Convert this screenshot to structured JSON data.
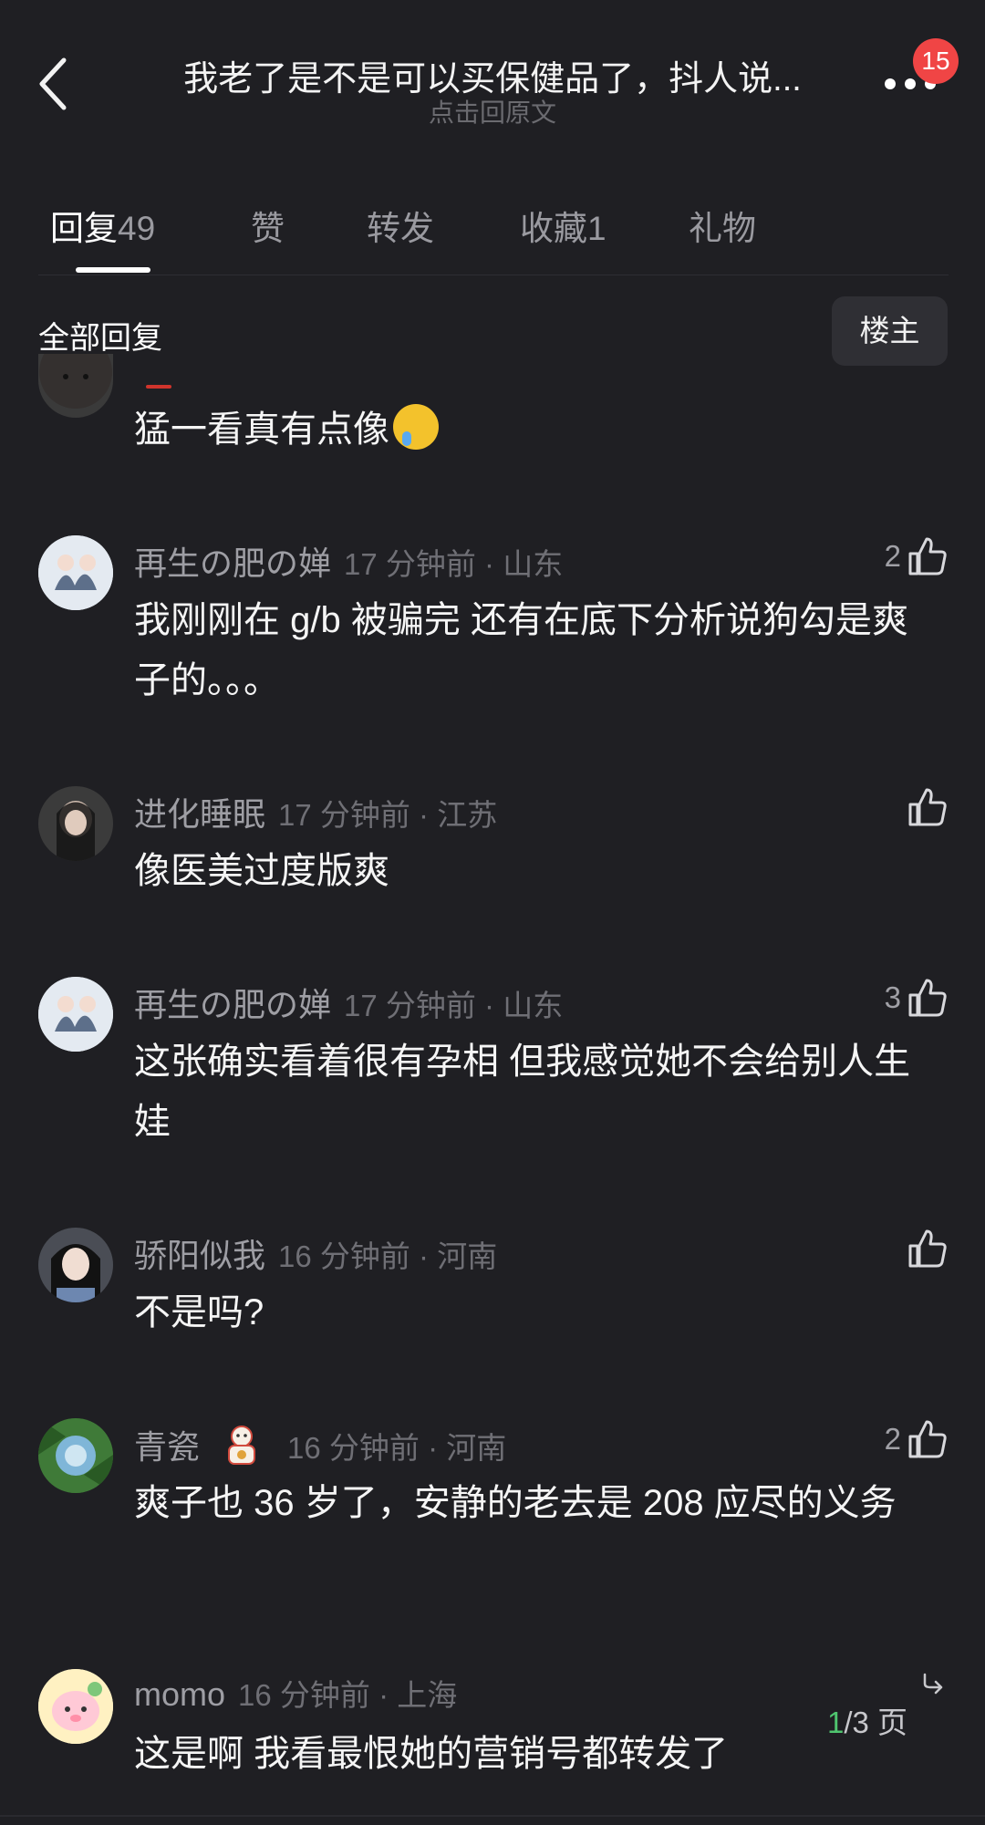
{
  "header": {
    "title": "我老了是不是可以买保健品了，抖人说...",
    "subtitle": "点击回原文",
    "notification_count": "15"
  },
  "tabs": [
    {
      "label": "回复",
      "count": "49"
    },
    {
      "label": "赞",
      "count": ""
    },
    {
      "label": "转发",
      "count": ""
    },
    {
      "label": "收藏",
      "count": "1"
    },
    {
      "label": "礼物",
      "count": ""
    }
  ],
  "section": {
    "label": "全部回复",
    "owner_button": "楼主"
  },
  "comments": [
    {
      "name": "",
      "meta": "",
      "text": "猛一看真有点像",
      "likes": ""
    },
    {
      "name": "再生の肥の婵",
      "meta": "17 分钟前 · 山东",
      "text": "我刚刚在 g/b 被骗完 还有在底下分析说狗勾是爽子的。。。",
      "likes": "2"
    },
    {
      "name": "进化睡眠",
      "meta": "17 分钟前 · 江苏",
      "text": "像医美过度版爽",
      "likes": ""
    },
    {
      "name": "再生の肥の婵",
      "meta": "17 分钟前 · 山东",
      "text": "这张确实看着很有孕相 但我感觉她不会给别人生娃",
      "likes": "3"
    },
    {
      "name": "骄阳似我",
      "meta": "16 分钟前 · 河南",
      "text": "不是吗?",
      "likes": ""
    },
    {
      "name": "青瓷",
      "meta": "16 分钟前 · 河南",
      "text": "爽子也 36 岁了，安静的老去是 208 应尽的义务",
      "likes": "2"
    },
    {
      "name": "momo",
      "meta": "16 分钟前 · 上海",
      "text": "这是啊 我看最恨她的营销号都转发了",
      "likes": ""
    }
  ],
  "pagination": {
    "current": "1",
    "total": "/3 页"
  },
  "colors": {
    "background": "#1f1f23",
    "badge": "#f04545",
    "page_current": "#4fc56f"
  }
}
